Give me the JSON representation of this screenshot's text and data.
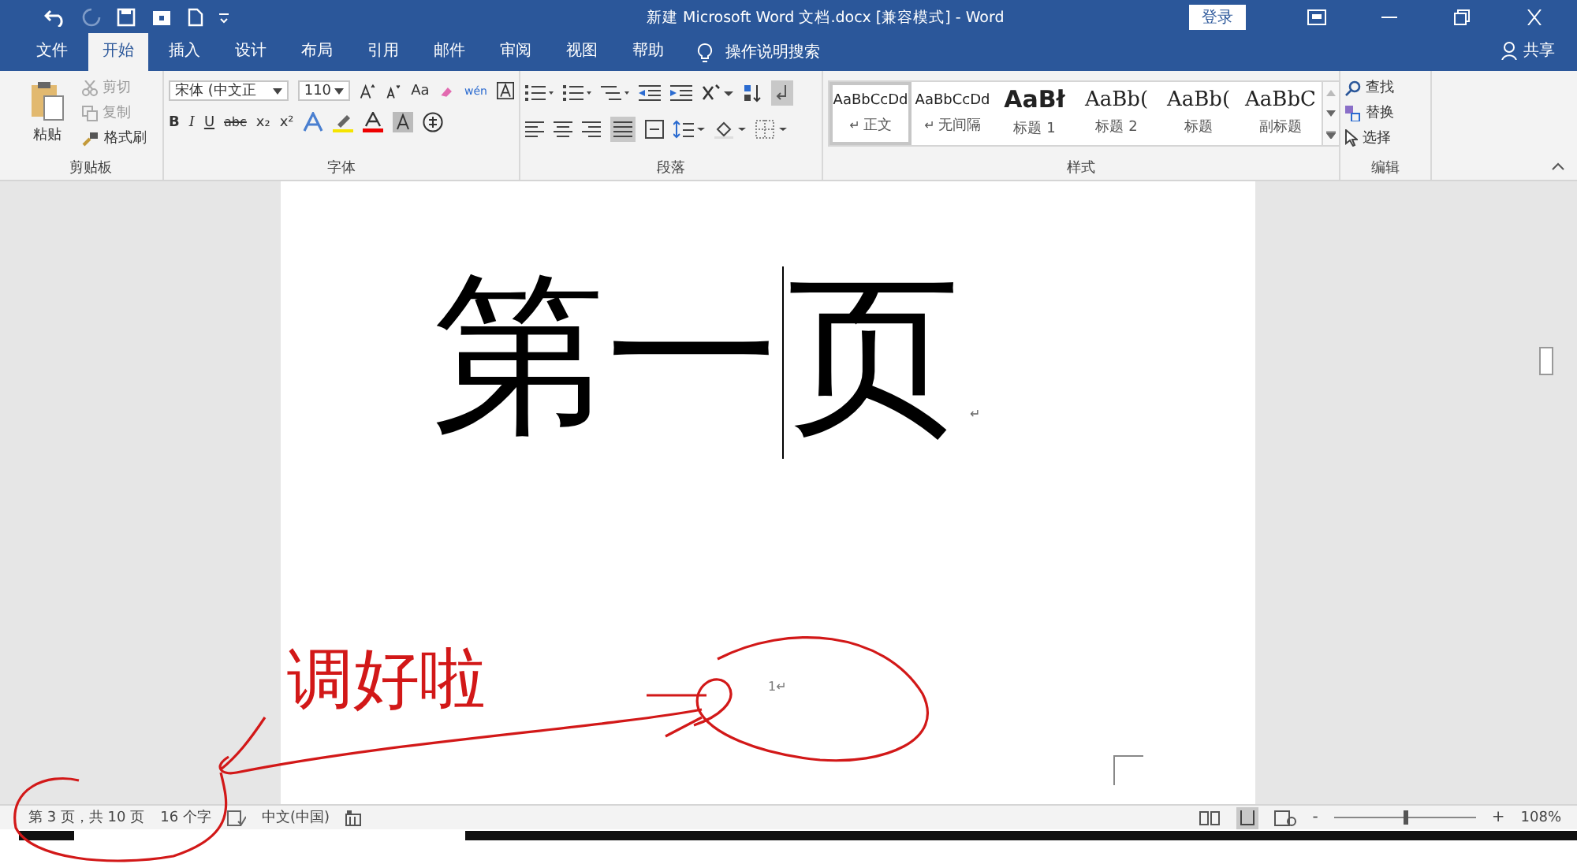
{
  "window": {
    "title": "新建 Microsoft Word 文档.docx [兼容模式] - Word",
    "login": "登录"
  },
  "tabs": [
    {
      "label": "文件",
      "selected": false
    },
    {
      "label": "开始",
      "selected": true
    },
    {
      "label": "插入",
      "selected": false
    },
    {
      "label": "设计",
      "selected": false
    },
    {
      "label": "布局",
      "selected": false
    },
    {
      "label": "引用",
      "selected": false
    },
    {
      "label": "邮件",
      "selected": false
    },
    {
      "label": "审阅",
      "selected": false
    },
    {
      "label": "视图",
      "selected": false
    },
    {
      "label": "帮助",
      "selected": false
    }
  ],
  "tell_me": {
    "placeholder": "操作说明搜索"
  },
  "share": "共享",
  "clipboard": {
    "paste": "粘贴",
    "cut": "剪切",
    "copy": "复制",
    "format_painter": "格式刷",
    "label": "剪贴板"
  },
  "font": {
    "name": "宋体 (中文正",
    "size": "110",
    "change_case": "Aa",
    "phonetic": "wén",
    "format_buttons": [
      "B",
      "I",
      "U",
      "abc",
      "x₂",
      "x²"
    ],
    "label": "字体"
  },
  "paragraph": {
    "label": "段落"
  },
  "styles": {
    "items": [
      {
        "preview": "AaBbCcDd",
        "name": "正文",
        "mark": "↵",
        "kind": "normal",
        "selected": true
      },
      {
        "preview": "AaBbCcDd",
        "name": "无间隔",
        "mark": "↵",
        "kind": "normal",
        "selected": false
      },
      {
        "preview": "AaBł",
        "name": "标题 1",
        "kind": "heading1",
        "selected": false
      },
      {
        "preview": "AaBb(",
        "name": "标题 2",
        "kind": "heading2",
        "selected": false
      },
      {
        "preview": "AaBb(",
        "name": "标题",
        "kind": "heading2",
        "selected": false
      },
      {
        "preview": "AaBbC",
        "name": "副标题",
        "kind": "heading2",
        "selected": false
      }
    ],
    "label": "样式"
  },
  "editing": {
    "find": "查找",
    "replace": "替换",
    "select": "选择",
    "label": "编辑"
  },
  "document": {
    "heading_before_cursor": "第一",
    "heading_after_cursor": "页",
    "paragraph_mark": "↵",
    "page_number": "1↵"
  },
  "annotation": {
    "text": "调好啦"
  },
  "status_bar": {
    "page": "第 3 页，共 10 页",
    "words": "16 个字",
    "language": "中文(中国)",
    "zoom_out": "-",
    "zoom_in": "+",
    "zoom": "108%",
    "zoom_slider": {
      "level": 0.5
    }
  }
}
